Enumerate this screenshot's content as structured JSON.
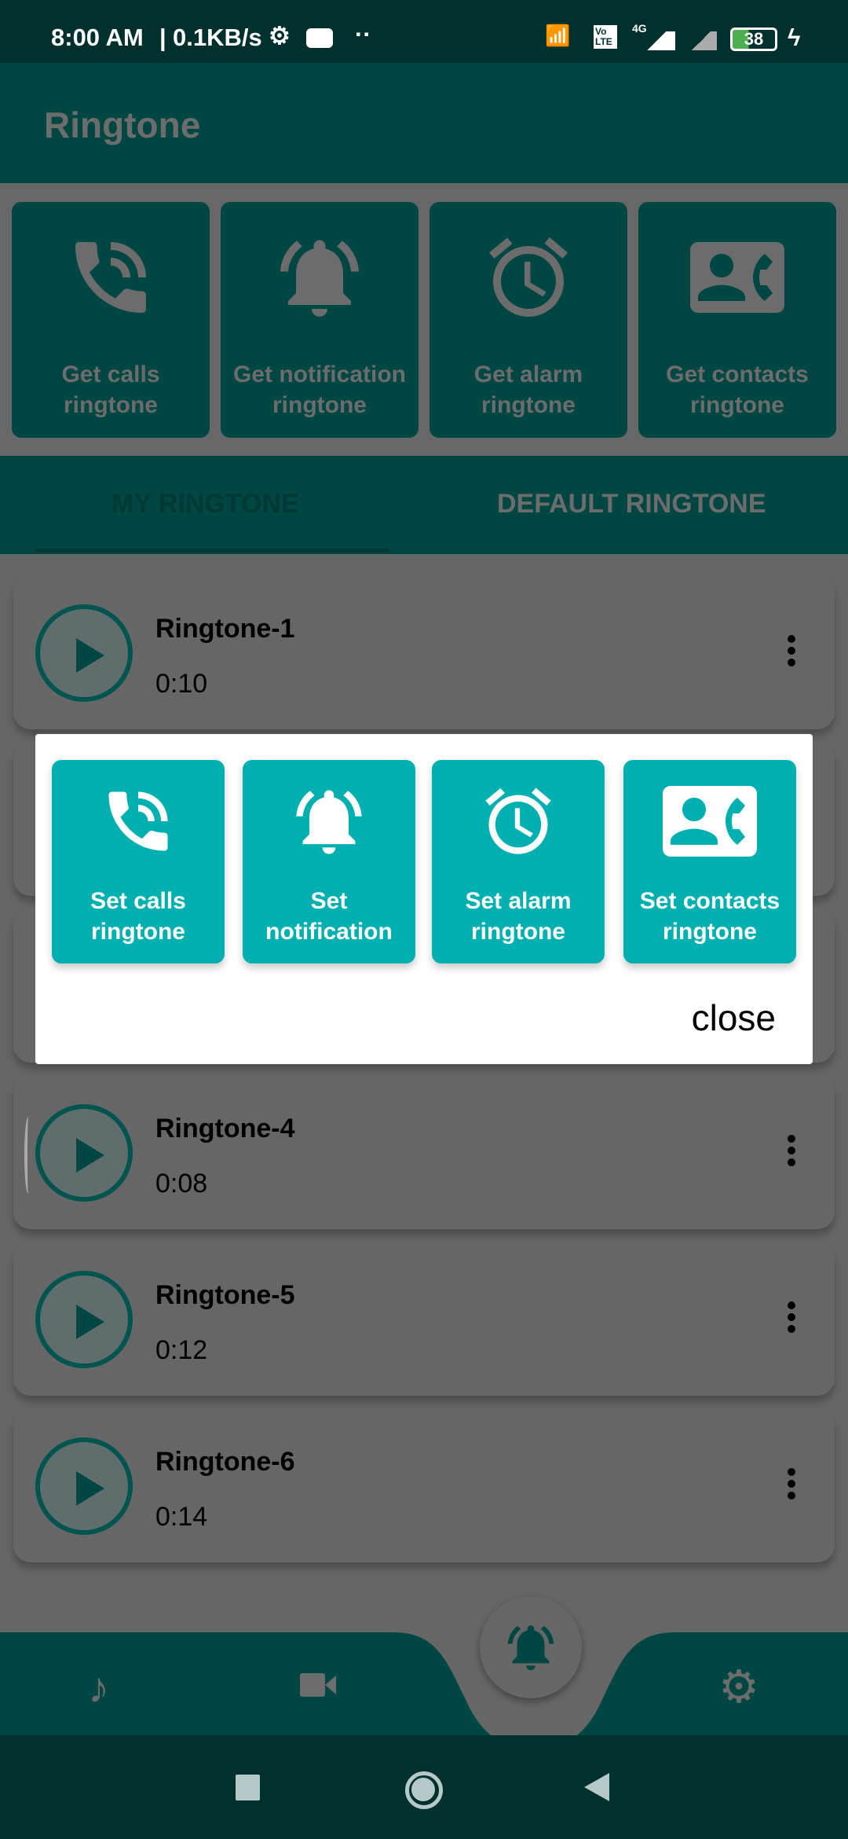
{
  "status_bar": {
    "time": "8:00 AM",
    "speed": "0.1KB/s",
    "network": "4G",
    "volte": "Vo LTE",
    "battery": "38"
  },
  "app_bar": {
    "title": "Ringtone"
  },
  "quick_actions": [
    {
      "label": "Get calls ringtone",
      "icon": "phone-ringing-icon"
    },
    {
      "label": "Get notification ringtone",
      "icon": "bell-ringing-icon"
    },
    {
      "label": "Get alarm ringtone",
      "icon": "alarm-clock-icon"
    },
    {
      "label": "Get contacts ringtone",
      "icon": "contact-phone-icon"
    }
  ],
  "tabs": [
    {
      "label": "MY RINGTONE",
      "selected": true
    },
    {
      "label": "DEFAULT RINGTONE",
      "selected": false
    }
  ],
  "ringtones": [
    {
      "name": "Ringtone-1",
      "duration": "0:10"
    },
    {
      "name": "Ringtone-4",
      "duration": "0:08"
    },
    {
      "name": "Ringtone-5",
      "duration": "0:12"
    },
    {
      "name": "Ringtone-6",
      "duration": "0:14"
    }
  ],
  "dialog": {
    "buttons": [
      {
        "label": "Set calls ringtone",
        "icon": "phone-ringing-icon"
      },
      {
        "label": "Set notification",
        "icon": "bell-ringing-icon"
      },
      {
        "label": "Set alarm ringtone",
        "icon": "alarm-clock-icon"
      },
      {
        "label": "Set contacts ringtone",
        "icon": "contact-phone-icon"
      }
    ],
    "close_label": "close"
  },
  "bottom_nav": [
    "music-note-icon",
    "video-camera-icon",
    "bell-ringing-icon",
    "gear-icon"
  ],
  "colors": {
    "accent": "#00b0b0",
    "primary_dim": "#004744",
    "statusbar": "#00302e"
  }
}
